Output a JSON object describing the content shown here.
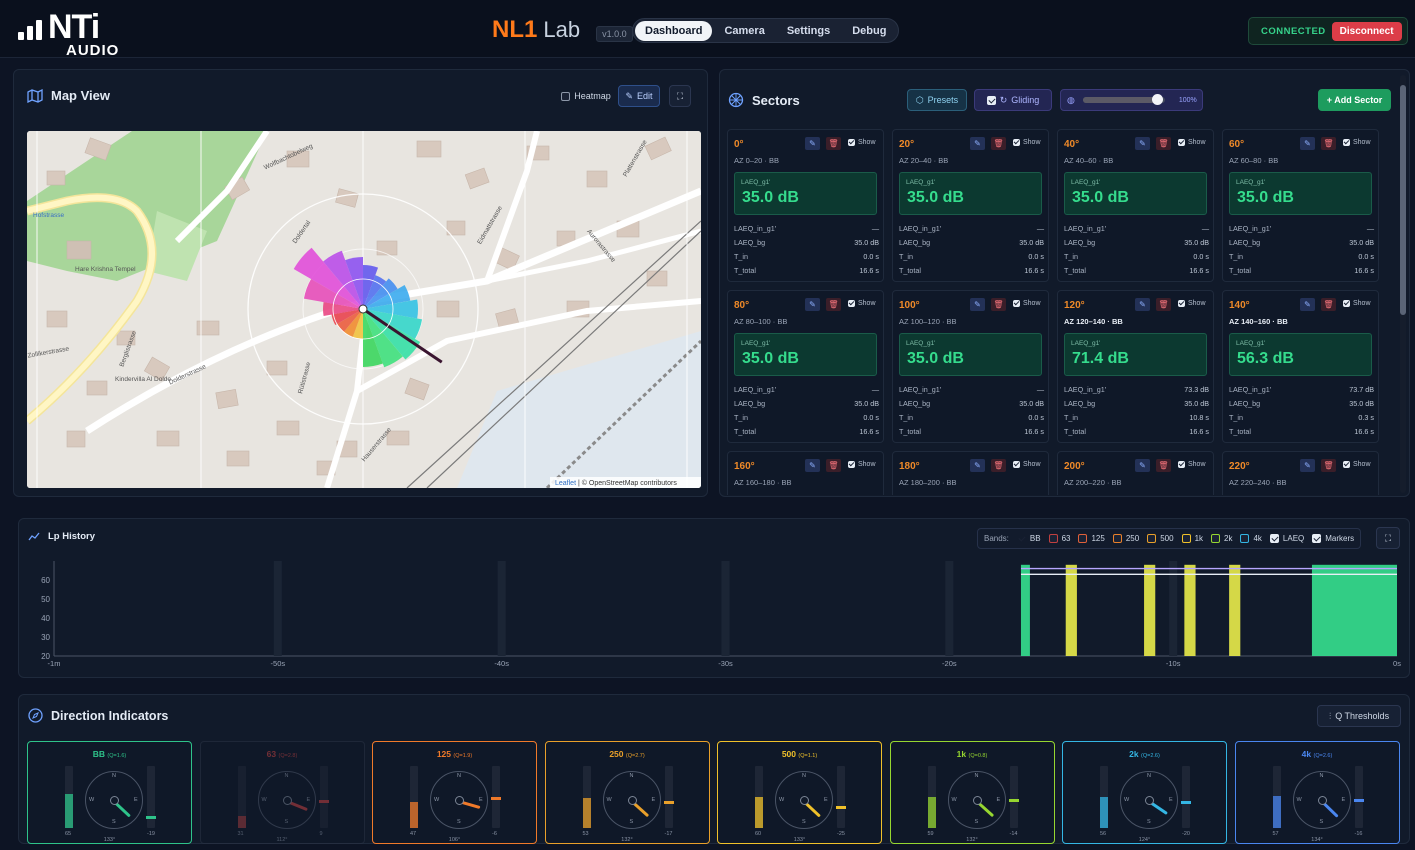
{
  "header": {
    "logo_text": "NTi",
    "logo_sub": "AUDIO",
    "brand_nl": "NL1",
    "brand_lab": "Lab",
    "version": "v1.0.0",
    "tabs": [
      {
        "label": "Dashboard",
        "active": true
      },
      {
        "label": "Camera",
        "active": false
      },
      {
        "label": "Settings",
        "active": false
      },
      {
        "label": "Debug",
        "active": false
      }
    ],
    "status": "CONNECTED",
    "disconnect": "Disconnect"
  },
  "map_view": {
    "title": "Map View",
    "heatmap_label": "Heatmap",
    "heatmap_checked": false,
    "edit_label": "Edit",
    "attribution_leaflet": "Leaflet",
    "attribution_text": "| © OpenStreetMap contributors",
    "labels": [
      "Hare Krishna Tempel",
      "Kindervilla Al Dolde",
      "Berglistrasse",
      "Doldertal",
      "Dolderstrasse",
      "Hauserstrasse",
      "Aurorastrasse",
      "Plattenstrasse",
      "Wolfbachtobelweg",
      "Hofstrasse",
      "Rütistrasse",
      "Eidmattstrasse",
      "Zollikerstrasse"
    ],
    "rose": {
      "max_az": [
        300,
        320,
        340,
        0,
        20,
        40,
        60,
        80,
        100,
        120,
        140,
        160,
        180,
        200,
        220,
        240,
        260,
        280
      ],
      "bearing": 124
    }
  },
  "sectors": {
    "title": "Sectors",
    "presets": "Presets",
    "gliding": "Gliding",
    "gliding_checked": true,
    "opacity": "100%",
    "opacity_value": 0.9,
    "add": "+ Add Sector",
    "cards": [
      {
        "angle": "0°",
        "az": "AZ 0–20 · BB",
        "value": "35.0 dB",
        "label": "LAEQ_g1'",
        "in": "—",
        "bg": "35.0 dB",
        "tin": "0.0 s",
        "ttot": "16.6 s"
      },
      {
        "angle": "20°",
        "az": "AZ 20–40 · BB",
        "value": "35.0 dB",
        "label": "LAEQ_g1'",
        "in": "—",
        "bg": "35.0 dB",
        "tin": "0.0 s",
        "ttot": "16.6 s"
      },
      {
        "angle": "40°",
        "az": "AZ 40–60 · BB",
        "value": "35.0 dB",
        "label": "LAEQ_g1'",
        "in": "—",
        "bg": "35.0 dB",
        "tin": "0.0 s",
        "ttot": "16.6 s"
      },
      {
        "angle": "60°",
        "az": "AZ 60–80 · BB",
        "value": "35.0 dB",
        "label": "LAEQ_g1'",
        "in": "—",
        "bg": "35.0 dB",
        "tin": "0.0 s",
        "ttot": "16.6 s"
      },
      {
        "angle": "80°",
        "az": "AZ 80–100 · BB",
        "value": "35.0 dB",
        "label": "LAEQ_g1'",
        "in": "—",
        "bg": "35.0 dB",
        "tin": "0.0 s",
        "ttot": "16.6 s"
      },
      {
        "angle": "100°",
        "az": "AZ 100–120 · BB",
        "value": "35.0 dB",
        "label": "LAEQ_g1'",
        "in": "—",
        "bg": "35.0 dB",
        "tin": "0.0 s",
        "ttot": "16.6 s"
      },
      {
        "angle": "120°",
        "az": "AZ 120–140 · BB",
        "value": "71.4 dB",
        "label": "LAEQ_g1'",
        "in": "73.3 dB",
        "bg": "35.0 dB",
        "tin": "10.8 s",
        "ttot": "16.6 s"
      },
      {
        "angle": "140°",
        "az": "AZ 140–160 · BB",
        "value": "56.3 dB",
        "label": "LAEQ_g1'",
        "in": "73.7 dB",
        "bg": "35.0 dB",
        "tin": "0.3 s",
        "ttot": "16.6 s"
      },
      {
        "angle": "160°",
        "az": "AZ 160–180 · BB"
      },
      {
        "angle": "180°",
        "az": "AZ 180–200 · BB"
      },
      {
        "angle": "200°",
        "az": "AZ 200–220 · BB"
      },
      {
        "angle": "220°",
        "az": "AZ 220–240 · BB"
      }
    ],
    "row_labels": {
      "in": "LAEQ_in_g1'",
      "bg": "LAEQ_bg",
      "tin": "T_in",
      "ttot": "T_total"
    },
    "edit_icon": "✎",
    "delete_icon": "🗑",
    "show": "Show"
  },
  "history": {
    "title": "Lp History",
    "bands_label": "Bands:",
    "bands": [
      {
        "label": "BB",
        "checked": true
      },
      {
        "label": "63",
        "checked": false
      },
      {
        "label": "125",
        "checked": false
      },
      {
        "label": "250",
        "checked": false
      },
      {
        "label": "500",
        "checked": false
      },
      {
        "label": "1k",
        "checked": false
      },
      {
        "label": "2k",
        "checked": false
      },
      {
        "label": "4k",
        "checked": false
      },
      {
        "label": "LAEQ",
        "checked": true
      },
      {
        "label": "Markers",
        "checked": true
      }
    ],
    "y_ticks": [
      "60",
      "50",
      "40",
      "30",
      "20"
    ],
    "x_ticks": [
      "-1m",
      "-50s",
      "-40s",
      "-30s",
      "-20s",
      "-10s",
      "0s"
    ]
  },
  "chart_data": {
    "type": "bar",
    "title": "Lp History",
    "xlim": [
      -60,
      0
    ],
    "ylim": [
      20,
      70
    ],
    "bars": [
      {
        "x0": -16.8,
        "x1": -16.4,
        "color": "#35dc8d"
      },
      {
        "x0": -14.8,
        "x1": -14.3,
        "color": "#e6e84a"
      },
      {
        "x0": -11.3,
        "x1": -10.8,
        "color": "#e6e84a"
      },
      {
        "x0": -9.5,
        "x1": -9.0,
        "color": "#e6e84a"
      },
      {
        "x0": -7.5,
        "x1": -7.0,
        "color": "#e6e84a"
      },
      {
        "x0": -3.8,
        "x1": 0,
        "color": "#35dc8d"
      }
    ],
    "series": [
      {
        "name": "LAEQ",
        "values": [
          [
            -16.8,
            66
          ],
          [
            0,
            66
          ]
        ]
      },
      {
        "name": "Markers",
        "values": [
          [
            -16.8,
            63
          ],
          [
            0,
            63
          ]
        ]
      }
    ]
  },
  "directions": {
    "title": "Direction Indicators",
    "thresholds": "Q Thresholds",
    "compass": {
      "n": "N",
      "e": "E",
      "s": "S",
      "w": "W"
    },
    "cards": [
      {
        "band": "BB",
        "q": "(Q=1.6)",
        "color": "#2ec38a",
        "left": "65",
        "right": "-19",
        "deg": "133°",
        "angle": 133,
        "lv": 0.55,
        "rv": 0.15,
        "dim": false
      },
      {
        "band": "63",
        "q": "(Q=2.8)",
        "color": "#c24040",
        "left": "31",
        "right": "9",
        "deg": "112°",
        "angle": 112,
        "lv": 0.2,
        "rv": 0.4,
        "dim": true
      },
      {
        "band": "125",
        "q": "(Q=1.9)",
        "color": "#f07a2a",
        "left": "47",
        "right": "-6",
        "deg": "106°",
        "angle": 106,
        "lv": 0.42,
        "rv": 0.45,
        "dim": false
      },
      {
        "band": "250",
        "q": "(Q=2.7)",
        "color": "#e9a02a",
        "left": "53",
        "right": "-17",
        "deg": "132°",
        "angle": 132,
        "lv": 0.48,
        "rv": 0.38,
        "dim": false
      },
      {
        "band": "500",
        "q": "(Q=1.1)",
        "color": "#f0c12a",
        "left": "60",
        "right": "-25",
        "deg": "133°",
        "angle": 133,
        "lv": 0.5,
        "rv": 0.3,
        "dim": false
      },
      {
        "band": "1k",
        "q": "(Q=0.8)",
        "color": "#96d630",
        "left": "59",
        "right": "-14",
        "deg": "132°",
        "angle": 132,
        "lv": 0.5,
        "rv": 0.42,
        "dim": false
      },
      {
        "band": "2k",
        "q": "(Q=2.6)",
        "color": "#34b6e4",
        "left": "56",
        "right": "-20",
        "deg": "124°",
        "angle": 124,
        "lv": 0.5,
        "rv": 0.38,
        "dim": false
      },
      {
        "band": "4k",
        "q": "(Q=2.6)",
        "color": "#4a86f0",
        "left": "57",
        "right": "-16",
        "deg": "134°",
        "angle": 134,
        "lv": 0.52,
        "rv": 0.42,
        "dim": false
      }
    ]
  }
}
